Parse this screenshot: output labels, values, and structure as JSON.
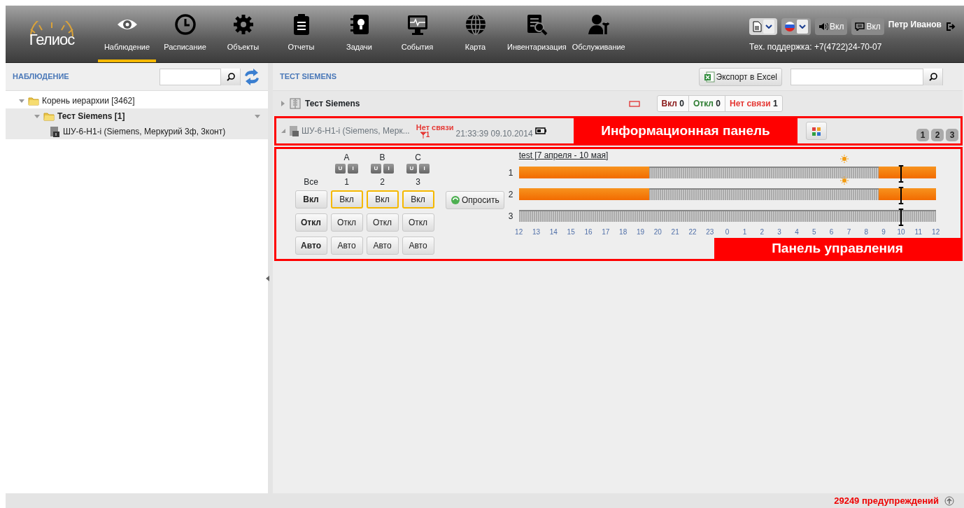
{
  "header": {
    "logo": "Гелиос",
    "nav": [
      {
        "label": "Наблюдение",
        "selected": true
      },
      {
        "label": "Расписание",
        "selected": false
      },
      {
        "label": "Объекты",
        "selected": false
      },
      {
        "label": "Отчеты",
        "selected": false
      },
      {
        "label": "Задачи",
        "selected": false
      },
      {
        "label": "События",
        "selected": false
      },
      {
        "label": "Карта",
        "selected": false
      },
      {
        "label": "Инвентаризация",
        "selected": false
      },
      {
        "label": "Обслуживание",
        "selected": false
      }
    ],
    "sound": "Вкл",
    "messages": "Вкл",
    "user": "Петр Иванов",
    "support": "Тех. поддержка: +7(4722)24-70-07"
  },
  "sidebar": {
    "title": "НАБЛЮДЕНИЕ",
    "tree": [
      {
        "label": "Корень иерархии [3462]",
        "kind": "folder",
        "expanded": true,
        "selected": false,
        "children": [
          {
            "label": "Тест Siemens [1]",
            "kind": "folder",
            "expanded": true,
            "selected": true,
            "children": [
              {
                "label": "ШУ-6-Н1-i (Siemens, Меркурий 3ф, 3конт)",
                "kind": "device",
                "selected": false
              }
            ]
          }
        ]
      }
    ]
  },
  "main": {
    "title": "ТЕСТ SIEMENS",
    "export_button": "Экспорт в Excel",
    "group": {
      "label": "Тест Siemens",
      "expanded": false,
      "counts": [
        {
          "label": "Вкл",
          "value": "0",
          "color": "#8b1a1a"
        },
        {
          "label": "Откл",
          "value": "0",
          "color": "#2e7d32"
        },
        {
          "label": "Нет связи",
          "value": "1",
          "color": "#e53935"
        }
      ]
    },
    "device": {
      "label": "ШУ-6-Н1-i (Siemens, Мерк...",
      "expanded": true,
      "status": "Нет связи",
      "signal": "1",
      "time": "21:33:39 09.10.2014"
    },
    "info_callout": "Информационная панель",
    "pages": [
      "1",
      "2",
      "3"
    ],
    "control": {
      "phases": [
        {
          "label": "A",
          "buttons": [
            "U",
            "I"
          ]
        },
        {
          "label": "B",
          "buttons": [
            "U",
            "I"
          ]
        },
        {
          "label": "C",
          "buttons": [
            "U",
            "I"
          ]
        }
      ],
      "columns": [
        "Все",
        "1",
        "2",
        "3"
      ],
      "rows": [
        {
          "buttons": [
            {
              "label": "Вкл",
              "selected": false
            },
            {
              "label": "Вкл",
              "selected": true
            },
            {
              "label": "Вкл",
              "selected": true
            },
            {
              "label": "Вкл",
              "selected": true
            }
          ]
        },
        {
          "buttons": [
            {
              "label": "Откл",
              "selected": false
            },
            {
              "label": "Откл",
              "selected": false
            },
            {
              "label": "Откл",
              "selected": false
            },
            {
              "label": "Откл",
              "selected": false
            }
          ]
        },
        {
          "buttons": [
            {
              "label": "Авто",
              "selected": false
            },
            {
              "label": "Авто",
              "selected": false
            },
            {
              "label": "Авто",
              "selected": false
            },
            {
              "label": "Авто",
              "selected": false
            }
          ]
        }
      ],
      "poll_button": "Опросить",
      "schedule": {
        "title": "test [7 апреля - 10 мая]",
        "lines": [
          {
            "label": "1",
            "sun": true,
            "marker": {
              "level": 0.917
            },
            "fills": [
              {
                "kind": "start",
                "level": 0.3125
              },
              {
                "kind": "end",
                "level": 0.1375
              }
            ]
          },
          {
            "label": "2",
            "sun": true,
            "marker": {
              "level": 0.917
            },
            "fills": [
              {
                "kind": "start",
                "level": 0.3125
              },
              {
                "kind": "end",
                "level": 0.1375
              }
            ]
          },
          {
            "label": "3",
            "sun": false,
            "marker": {
              "level": 0.917
            }
          }
        ],
        "ticks": [
          "12",
          "13",
          "14",
          "15",
          "16",
          "17",
          "18",
          "19",
          "20",
          "21",
          "22",
          "23",
          "0",
          "1",
          "2",
          "3",
          "4",
          "5",
          "6",
          "7",
          "8",
          "9",
          "10",
          "11",
          "12"
        ]
      },
      "callout": "Панель управления"
    }
  },
  "footer": {
    "warnings": "29249 предупреждений"
  }
}
